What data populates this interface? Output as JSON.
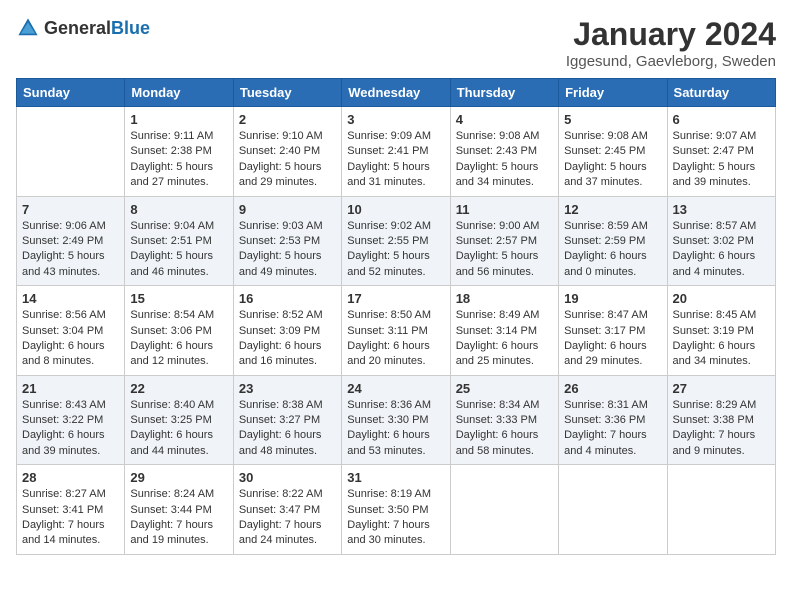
{
  "header": {
    "logo_general": "General",
    "logo_blue": "Blue",
    "month": "January 2024",
    "location": "Iggesund, Gaevleborg, Sweden"
  },
  "weekdays": [
    "Sunday",
    "Monday",
    "Tuesday",
    "Wednesday",
    "Thursday",
    "Friday",
    "Saturday"
  ],
  "weeks": [
    [
      {
        "day": "",
        "info": ""
      },
      {
        "day": "1",
        "info": "Sunrise: 9:11 AM\nSunset: 2:38 PM\nDaylight: 5 hours\nand 27 minutes."
      },
      {
        "day": "2",
        "info": "Sunrise: 9:10 AM\nSunset: 2:40 PM\nDaylight: 5 hours\nand 29 minutes."
      },
      {
        "day": "3",
        "info": "Sunrise: 9:09 AM\nSunset: 2:41 PM\nDaylight: 5 hours\nand 31 minutes."
      },
      {
        "day": "4",
        "info": "Sunrise: 9:08 AM\nSunset: 2:43 PM\nDaylight: 5 hours\nand 34 minutes."
      },
      {
        "day": "5",
        "info": "Sunrise: 9:08 AM\nSunset: 2:45 PM\nDaylight: 5 hours\nand 37 minutes."
      },
      {
        "day": "6",
        "info": "Sunrise: 9:07 AM\nSunset: 2:47 PM\nDaylight: 5 hours\nand 39 minutes."
      }
    ],
    [
      {
        "day": "7",
        "info": "Sunrise: 9:06 AM\nSunset: 2:49 PM\nDaylight: 5 hours\nand 43 minutes."
      },
      {
        "day": "8",
        "info": "Sunrise: 9:04 AM\nSunset: 2:51 PM\nDaylight: 5 hours\nand 46 minutes."
      },
      {
        "day": "9",
        "info": "Sunrise: 9:03 AM\nSunset: 2:53 PM\nDaylight: 5 hours\nand 49 minutes."
      },
      {
        "day": "10",
        "info": "Sunrise: 9:02 AM\nSunset: 2:55 PM\nDaylight: 5 hours\nand 52 minutes."
      },
      {
        "day": "11",
        "info": "Sunrise: 9:00 AM\nSunset: 2:57 PM\nDaylight: 5 hours\nand 56 minutes."
      },
      {
        "day": "12",
        "info": "Sunrise: 8:59 AM\nSunset: 2:59 PM\nDaylight: 6 hours\nand 0 minutes."
      },
      {
        "day": "13",
        "info": "Sunrise: 8:57 AM\nSunset: 3:02 PM\nDaylight: 6 hours\nand 4 minutes."
      }
    ],
    [
      {
        "day": "14",
        "info": "Sunrise: 8:56 AM\nSunset: 3:04 PM\nDaylight: 6 hours\nand 8 minutes."
      },
      {
        "day": "15",
        "info": "Sunrise: 8:54 AM\nSunset: 3:06 PM\nDaylight: 6 hours\nand 12 minutes."
      },
      {
        "day": "16",
        "info": "Sunrise: 8:52 AM\nSunset: 3:09 PM\nDaylight: 6 hours\nand 16 minutes."
      },
      {
        "day": "17",
        "info": "Sunrise: 8:50 AM\nSunset: 3:11 PM\nDaylight: 6 hours\nand 20 minutes."
      },
      {
        "day": "18",
        "info": "Sunrise: 8:49 AM\nSunset: 3:14 PM\nDaylight: 6 hours\nand 25 minutes."
      },
      {
        "day": "19",
        "info": "Sunrise: 8:47 AM\nSunset: 3:17 PM\nDaylight: 6 hours\nand 29 minutes."
      },
      {
        "day": "20",
        "info": "Sunrise: 8:45 AM\nSunset: 3:19 PM\nDaylight: 6 hours\nand 34 minutes."
      }
    ],
    [
      {
        "day": "21",
        "info": "Sunrise: 8:43 AM\nSunset: 3:22 PM\nDaylight: 6 hours\nand 39 minutes."
      },
      {
        "day": "22",
        "info": "Sunrise: 8:40 AM\nSunset: 3:25 PM\nDaylight: 6 hours\nand 44 minutes."
      },
      {
        "day": "23",
        "info": "Sunrise: 8:38 AM\nSunset: 3:27 PM\nDaylight: 6 hours\nand 48 minutes."
      },
      {
        "day": "24",
        "info": "Sunrise: 8:36 AM\nSunset: 3:30 PM\nDaylight: 6 hours\nand 53 minutes."
      },
      {
        "day": "25",
        "info": "Sunrise: 8:34 AM\nSunset: 3:33 PM\nDaylight: 6 hours\nand 58 minutes."
      },
      {
        "day": "26",
        "info": "Sunrise: 8:31 AM\nSunset: 3:36 PM\nDaylight: 7 hours\nand 4 minutes."
      },
      {
        "day": "27",
        "info": "Sunrise: 8:29 AM\nSunset: 3:38 PM\nDaylight: 7 hours\nand 9 minutes."
      }
    ],
    [
      {
        "day": "28",
        "info": "Sunrise: 8:27 AM\nSunset: 3:41 PM\nDaylight: 7 hours\nand 14 minutes."
      },
      {
        "day": "29",
        "info": "Sunrise: 8:24 AM\nSunset: 3:44 PM\nDaylight: 7 hours\nand 19 minutes."
      },
      {
        "day": "30",
        "info": "Sunrise: 8:22 AM\nSunset: 3:47 PM\nDaylight: 7 hours\nand 24 minutes."
      },
      {
        "day": "31",
        "info": "Sunrise: 8:19 AM\nSunset: 3:50 PM\nDaylight: 7 hours\nand 30 minutes."
      },
      {
        "day": "",
        "info": ""
      },
      {
        "day": "",
        "info": ""
      },
      {
        "day": "",
        "info": ""
      }
    ]
  ]
}
